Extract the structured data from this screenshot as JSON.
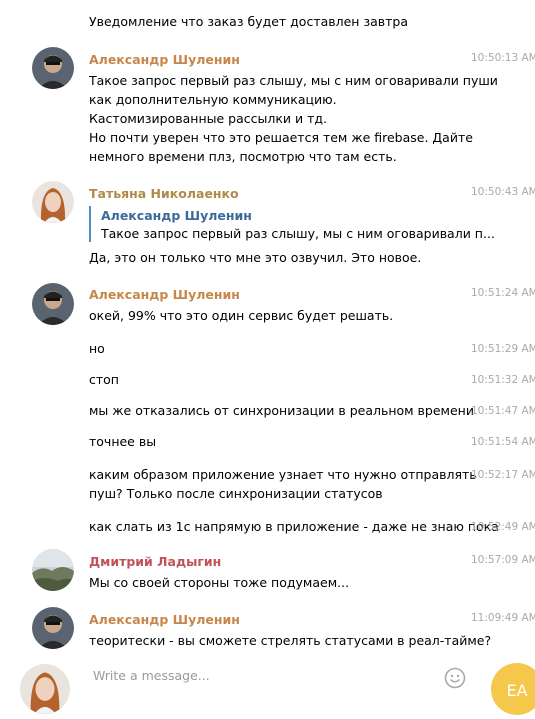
{
  "messages": {
    "m0": {
      "line1": "Уведомление что заказ будет доставлен завтра"
    },
    "m1": {
      "author": "Александр Шуленин",
      "time": "10:50:13 AM",
      "lines": [
        "Такое запрос первый раз слышу, мы с ним оговаривали пуши",
        "как дополнительную коммуникацию.",
        "Кастомизированные рассылки и тд.",
        "Но почти уверен что это решается тем же firebase. Дайте",
        "немного времени плз, посмотрю что там есть."
      ]
    },
    "m2": {
      "author": "Татьяна Николаенко",
      "time": "10:50:43 AM",
      "quote_author": "Александр Шуленин",
      "quote_text": "Такое запрос первый раз слышу, мы с ним оговаривали п...",
      "text": "Да, это он только что мне это озвучил. Это новое."
    },
    "m3": {
      "author": "Александр Шуленин",
      "time": "10:51:24 AM",
      "text": "окей, 99% что это один сервис будет решать."
    },
    "m4": {
      "time": "10:51:29 AM",
      "text": "но"
    },
    "m5": {
      "time": "10:51:32 AM",
      "text": "стоп"
    },
    "m6": {
      "time": "10:51:47 AM",
      "text": "мы же отказались от синхронизации в реальном времени"
    },
    "m7": {
      "time": "10:51:54 AM",
      "text": "точнее вы"
    },
    "m8": {
      "time": "10:52:17 AM",
      "line1": "каким образом приложение узнает что нужно отправлять",
      "line2": "пуш? Только после синхронизации статусов"
    },
    "m9": {
      "time": "10:52:49 AM",
      "text": "как слать из 1с напрямую в приложение - даже не знаю пока"
    },
    "m10": {
      "author": "Дмитрий Ладыгин",
      "time": "10:57:09 AM",
      "text": "Мы со своей стороны тоже подумаем..."
    },
    "m11": {
      "author": "Александр Шуленин",
      "time": "11:09:49 AM",
      "text": "теоритески - вы сможете стрелять статусами в реал-тайме?"
    }
  },
  "composer": {
    "placeholder": "Write a message...",
    "user_initials": "EA"
  },
  "colors": {
    "name_alexander": "#c8874a",
    "name_tatiana": "#b08a4a",
    "name_dmitry": "#c0525a",
    "quote_border": "#4a8fcc",
    "time": "#a9a9a9",
    "user_badge": "#f5c84c"
  }
}
